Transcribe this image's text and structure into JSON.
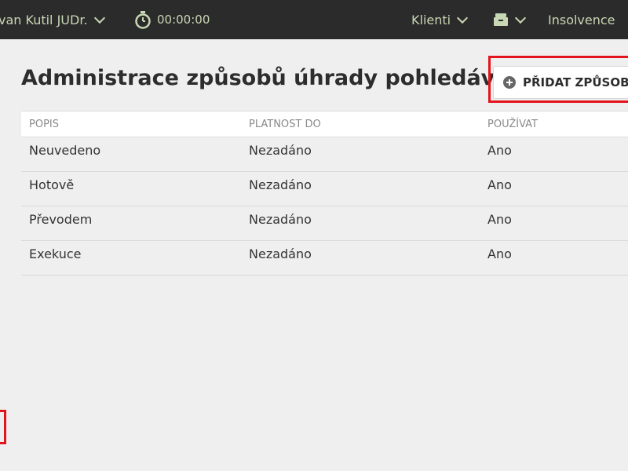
{
  "topbar": {
    "user_label": "van Kutil JUDr.",
    "timer": "00:00:00",
    "clients_label": "Klienti",
    "insolvence_label": "Insolvence"
  },
  "page": {
    "title": "Administrace způsobů úhrady pohledávek",
    "add_button_label": "PŘIDAT ZPŮSOB"
  },
  "table": {
    "headers": [
      "POPIS",
      "PLATNOST DO",
      "POUŽÍVAT"
    ],
    "rows": [
      [
        "Neuvedeno",
        "Nezadáno",
        "Ano"
      ],
      [
        "Hotově",
        "Nezadáno",
        "Ano"
      ],
      [
        "Převodem",
        "Nezadáno",
        "Ano"
      ],
      [
        "Exekuce",
        "Nezadáno",
        "Ano"
      ]
    ]
  },
  "colors": {
    "topbar_bg": "#2b2b2b",
    "topbar_text": "#c8d7b4",
    "highlight": "#e4141c"
  }
}
